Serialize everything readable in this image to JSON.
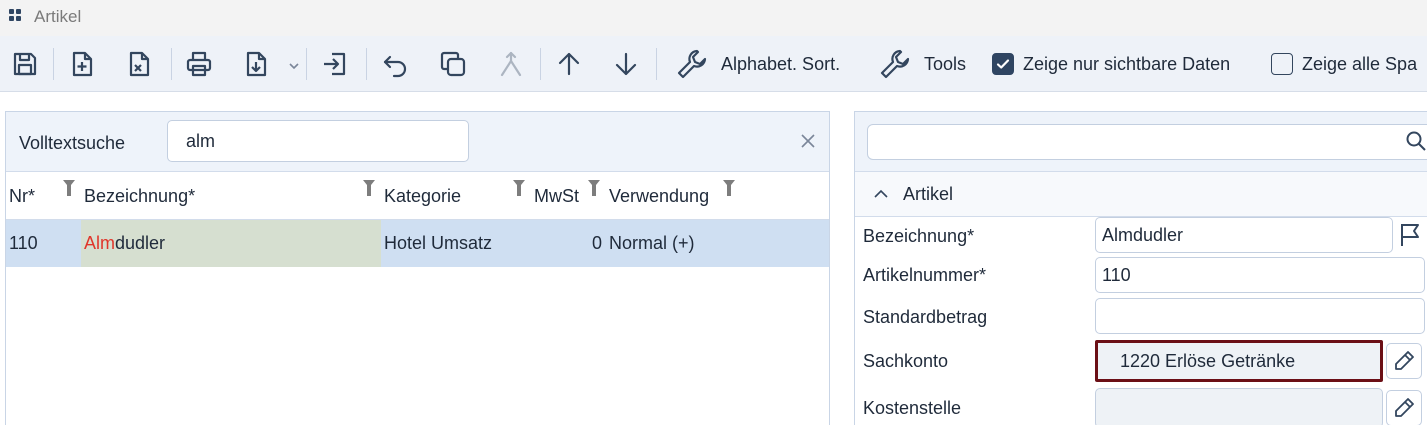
{
  "window": {
    "title": "Artikel"
  },
  "toolbar": {
    "sort_label": "Alphabet. Sort.",
    "tools_label": "Tools",
    "visible_only_label": "Zeige nur sichtbare Daten",
    "visible_only_checked": true,
    "show_all_label": "Zeige alle Spa",
    "show_all_checked": false
  },
  "search": {
    "label": "Volltextsuche",
    "value": "alm"
  },
  "table": {
    "columns": [
      "Nr*",
      "Bezeichnung*",
      "Kategorie",
      "MwSt",
      "Verwendung"
    ],
    "rows": [
      {
        "nr": "110",
        "bez_match": "Alm",
        "bez_rest": "dudler",
        "kategorie": "Hotel Umsatz",
        "mwst": "0",
        "verwendung": "Normal (+)"
      }
    ]
  },
  "detail": {
    "section_title": "Artikel",
    "fields": [
      {
        "label": "Bezeichnung*",
        "value": "Almdudler"
      },
      {
        "label": "Artikelnummer*",
        "value": "110"
      },
      {
        "label": "Standardbetrag",
        "value": ""
      },
      {
        "label": "Sachkonto",
        "value": "1220 Erlöse Getränke"
      },
      {
        "label": "Kostenstelle",
        "value": ""
      }
    ]
  },
  "colors": {
    "accent": "#2f4562",
    "highlight": "#e0362b",
    "selection": "#cfdff2",
    "focus_border": "#6b0f16"
  }
}
